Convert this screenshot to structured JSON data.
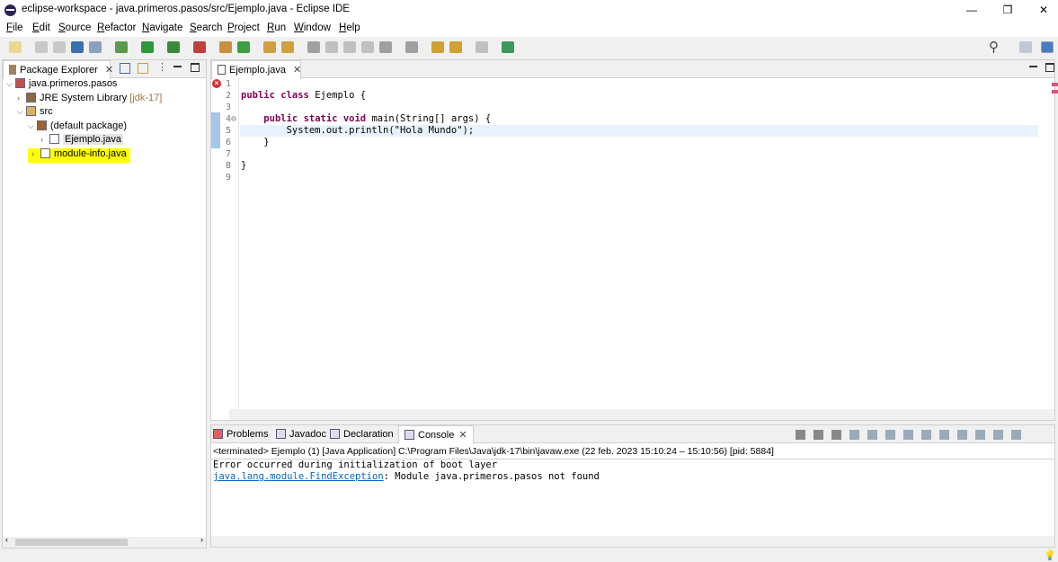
{
  "window": {
    "title": "eclipse-workspace - java.primeros.pasos/src/Ejemplo.java - Eclipse IDE",
    "minimize": "—",
    "restore": "❐",
    "close": "✕"
  },
  "menu": [
    "File",
    "Edit",
    "Source",
    "Refactor",
    "Navigate",
    "Search",
    "Project",
    "Run",
    "Window",
    "Help"
  ],
  "toolbar": {
    "icons": [
      {
        "name": "new-icon",
        "color": "#e8d890"
      },
      {
        "name": "save-icon",
        "color": "#c8c8c8"
      },
      {
        "name": "save-all-icon",
        "color": "#c8c8c8"
      },
      {
        "name": "terminal-icon",
        "color": "#3a6fb0"
      },
      {
        "name": "skip-breakpoints-icon",
        "color": "#8aa0c0"
      },
      {
        "name": "debug-icon",
        "color": "#5a9a4a"
      },
      {
        "name": "run-icon",
        "color": "#2a9a3a"
      },
      {
        "name": "coverage-icon",
        "color": "#3a8a3a"
      },
      {
        "name": "external-tools-icon",
        "color": "#c04040"
      },
      {
        "name": "new-package-icon",
        "color": "#c89040"
      },
      {
        "name": "new-class-icon",
        "color": "#3aa040"
      },
      {
        "name": "open-type-icon",
        "color": "#d0a040"
      },
      {
        "name": "search-tool-icon",
        "color": "#d0a040"
      },
      {
        "name": "pin-icon",
        "color": "#a0a0a0"
      },
      {
        "name": "mark-occurrences-icon",
        "color": "#c0c0c0"
      },
      {
        "name": "block-selection-icon",
        "color": "#c0c0c0"
      },
      {
        "name": "show-whitespace-icon",
        "color": "#c0c0c0"
      },
      {
        "name": "next-annotation-icon",
        "color": "#a0a0a0"
      },
      {
        "name": "prev-annotation-icon",
        "color": "#a0a0a0"
      },
      {
        "name": "last-edit-icon",
        "color": "#d0a030"
      },
      {
        "name": "back-icon",
        "color": "#d0a030"
      },
      {
        "name": "forward-icon",
        "color": "#c0c0c0"
      },
      {
        "name": "open-perspective-icon",
        "color": "#3a9a5a"
      }
    ],
    "search_icon": "⚲"
  },
  "package_explorer": {
    "tab": "Package Explorer",
    "tree": [
      {
        "label": "java.primeros.pasos",
        "suffix": "",
        "icon": "project-icon",
        "expanded": true
      },
      {
        "label": "JRE System Library",
        "suffix": " [jdk-17]",
        "icon": "library-icon",
        "expanded": false
      },
      {
        "label": "src",
        "suffix": "",
        "icon": "source-folder-icon",
        "expanded": true
      },
      {
        "label": "(default package)",
        "suffix": "",
        "icon": "package-icon",
        "expanded": true
      },
      {
        "label": "Ejemplo.java",
        "suffix": "",
        "icon": "java-file-icon",
        "expanded": false,
        "selected": true
      },
      {
        "label": "module-info.java",
        "suffix": "",
        "icon": "java-file-icon",
        "expanded": false,
        "highlighted": true
      }
    ]
  },
  "editor": {
    "tab": "Ejemplo.java",
    "lines": [
      {
        "n": "1",
        "code": ""
      },
      {
        "n": "2",
        "code": "public class Ejemplo {"
      },
      {
        "n": "3",
        "code": ""
      },
      {
        "n": "4",
        "code": "    public static void main(String[] args) {"
      },
      {
        "n": "5",
        "code": "        System.out.println(\"Hola Mundo\");"
      },
      {
        "n": "6",
        "code": "    }"
      },
      {
        "n": "7",
        "code": ""
      },
      {
        "n": "8",
        "code": "}"
      },
      {
        "n": "9",
        "code": ""
      }
    ]
  },
  "bottom": {
    "tabs": [
      "Problems",
      "Javadoc",
      "Declaration",
      "Console"
    ],
    "active": "Console",
    "status": "<terminated> Ejemplo (1) [Java Application] C:\\Program Files\\Java\\jdk-17\\bin\\javaw.exe  (22 feb. 2023 15:10:24 – 15:10:56) [pid: 5884]",
    "output_line1": "Error occurred during initialization of boot layer",
    "exception_link": "java.lang.module.FindException",
    "exception_msg": ": Module java.primeros.pasos not found"
  },
  "colors": {
    "highlight": "#ffff00",
    "selection": "#e5e5e5",
    "current_line": "#e8f2fe",
    "keyword": "#7f0055",
    "link": "#0066cc"
  }
}
